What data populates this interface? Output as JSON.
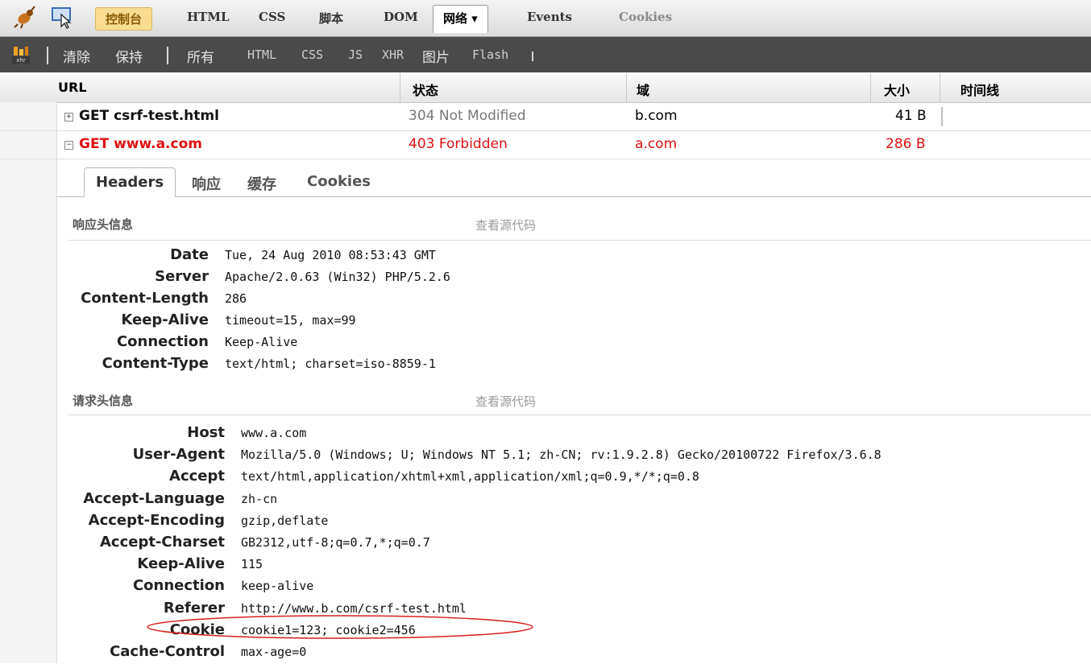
{
  "toolbar": {
    "tabs": [
      {
        "label": "控制台"
      },
      {
        "label": "HTML"
      },
      {
        "label": "CSS"
      },
      {
        "label": "脚本"
      },
      {
        "label": "DOM"
      },
      {
        "label": "网络 ▾"
      },
      {
        "label": "Events"
      },
      {
        "label": "Cookies"
      }
    ]
  },
  "net_toolbar": {
    "clear": "清除",
    "persist": "保持",
    "all": "所有",
    "filters": [
      "HTML",
      "CSS",
      "JS",
      "XHR",
      "图片",
      "Flash"
    ],
    "icon_label": "xhr"
  },
  "table": {
    "columns": [
      "URL",
      "状态",
      "域",
      "大小",
      "时间线"
    ],
    "rows": [
      {
        "toggle": "+",
        "method_url": "GET csrf-test.html",
        "status": "304 Not Modified",
        "domain": "b.com",
        "size": "41 B"
      },
      {
        "toggle": "−",
        "method_url": "GET www.a.com",
        "status": "403 Forbidden",
        "domain": "a.com",
        "size": "286 B"
      }
    ]
  },
  "detail": {
    "tabs": [
      "Headers",
      "响应",
      "缓存",
      "Cookies"
    ],
    "response_section": "响应头信息",
    "request_section": "请求头信息",
    "view_source": "查看源代码",
    "response_headers": [
      {
        "name": "Date",
        "value": "Tue, 24 Aug 2010 08:53:43 GMT"
      },
      {
        "name": "Server",
        "value": "Apache/2.0.63 (Win32) PHP/5.2.6"
      },
      {
        "name": "Content-Length",
        "value": "286"
      },
      {
        "name": "Keep-Alive",
        "value": "timeout=15, max=99"
      },
      {
        "name": "Connection",
        "value": "Keep-Alive"
      },
      {
        "name": "Content-Type",
        "value": "text/html; charset=iso-8859-1"
      }
    ],
    "request_headers": [
      {
        "name": "Host",
        "value": "www.a.com"
      },
      {
        "name": "User-Agent",
        "value": "Mozilla/5.0 (Windows; U; Windows NT 5.1; zh-CN; rv:1.9.2.8) Gecko/20100722 Firefox/3.6.8"
      },
      {
        "name": "Accept",
        "value": "text/html,application/xhtml+xml,application/xml;q=0.9,*/*;q=0.8"
      },
      {
        "name": "Accept-Language",
        "value": "zh-cn"
      },
      {
        "name": "Accept-Encoding",
        "value": "gzip,deflate"
      },
      {
        "name": "Accept-Charset",
        "value": "GB2312,utf-8;q=0.7,*;q=0.7"
      },
      {
        "name": "Keep-Alive",
        "value": "115"
      },
      {
        "name": "Connection",
        "value": "keep-alive"
      },
      {
        "name": "Referer",
        "value": "http://www.b.com/csrf-test.html"
      },
      {
        "name": "Cookie",
        "value": "cookie1=123; cookie2=456"
      },
      {
        "name": "Cache-Control",
        "value": "max-age=0"
      }
    ]
  },
  "colors": {
    "error": "#e01010",
    "highlight_ellipse": "#d42020",
    "active_tab": "#f7dc91"
  },
  "icons": [
    "firebug-bug-icon",
    "inspect-element-icon",
    "xhr-icon",
    "expand-toggle-icon",
    "collapse-toggle-icon"
  ]
}
